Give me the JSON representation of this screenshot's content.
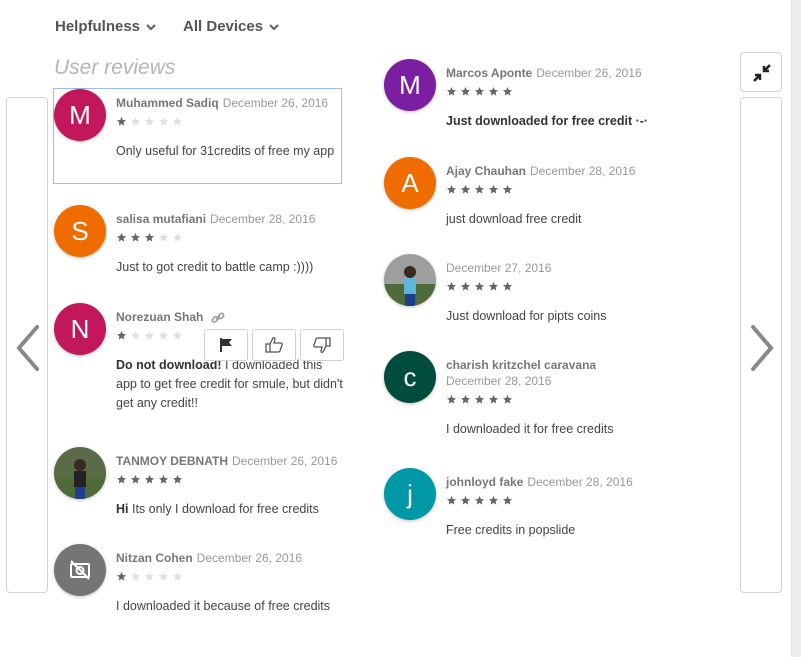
{
  "filters": [
    {
      "label": "Helpfulness",
      "icon": "chevron-down-icon"
    },
    {
      "label": "All Devices",
      "icon": "chevron-down-icon"
    }
  ],
  "section_title": "User reviews",
  "controls": {
    "prev_icon": "chevron-left-icon",
    "next_icon": "chevron-right-icon",
    "collapse_icon": "collapse-arrows-icon"
  },
  "colors": {
    "star_filled": "#666666",
    "star_empty": "#e0e0e0",
    "selection_outline": "#9bbcef"
  },
  "reviews_left": [
    {
      "author": "Muhammed Sadiq",
      "date": "December 26, 2016",
      "rating": 1,
      "bold_title": "",
      "text": "Only useful for 31credits of free my app",
      "avatar_letter": "M",
      "avatar_color": "#c2185b",
      "selected": true
    },
    {
      "author": "salisa mutafiani",
      "date": "December 28, 2016",
      "rating": 3,
      "bold_title": "",
      "text": "Just to got credit to battle camp :))))",
      "avatar_letter": "S",
      "avatar_color": "#ef6c00"
    },
    {
      "author": "Norezuan Shah",
      "date": "",
      "rating": 1,
      "bold_title": "Do not download!",
      "text": " I downloaded this app to get free credit for smule, but didn't get any credit!!",
      "avatar_letter": "N",
      "avatar_color": "#c2185b",
      "has_link": true,
      "actions": [
        "flag-icon",
        "thumbs-up-icon",
        "thumbs-down-icon"
      ]
    },
    {
      "author": "TANMOY DEBNATH",
      "date": "December 26, 2016",
      "rating": 5,
      "bold_title": "Hi",
      "text": " Its only I download for free credits",
      "avatar_letter": "",
      "avatar_color": "#5a6b48",
      "photo": true
    },
    {
      "author": "Nitzan Cohen",
      "date": "December 26, 2016",
      "rating": 1,
      "bold_title": "",
      "text": "I downloaded it because of free credits",
      "avatar_letter": "",
      "avatar_color": "#757575",
      "no_photo_icon": true
    }
  ],
  "reviews_right": [
    {
      "author": "Marcos Aponte",
      "date": "December 26, 2016",
      "rating": 5,
      "bold_title": "Just downloaded for free credit ·-·",
      "text": "",
      "avatar_letter": "M",
      "avatar_color": "#7b1fa2"
    },
    {
      "author": "Ajay Chauhan",
      "date": "December 28, 2016",
      "rating": 5,
      "bold_title": "",
      "text": "just download free credit",
      "avatar_letter": "A",
      "avatar_color": "#ef6c00"
    },
    {
      "author": "",
      "date": "December 27, 2016",
      "rating": 5,
      "bold_title": "",
      "text": "Just download for pipts coins",
      "avatar_letter": "",
      "avatar_color": "#9e9e9e",
      "photo": true
    },
    {
      "author": "charish kritzchel caravana",
      "date": "December 28, 2016",
      "rating": 5,
      "bold_title": "",
      "text": "I downloaded it for free credits",
      "avatar_letter": "c",
      "avatar_color": "#004d40",
      "date_block": true
    },
    {
      "author": "johnloyd fake",
      "date": "December 28, 2016",
      "rating": 5,
      "bold_title": "",
      "text": "Free credits in popslide",
      "avatar_letter": "j",
      "avatar_color": "#0097a7"
    }
  ]
}
